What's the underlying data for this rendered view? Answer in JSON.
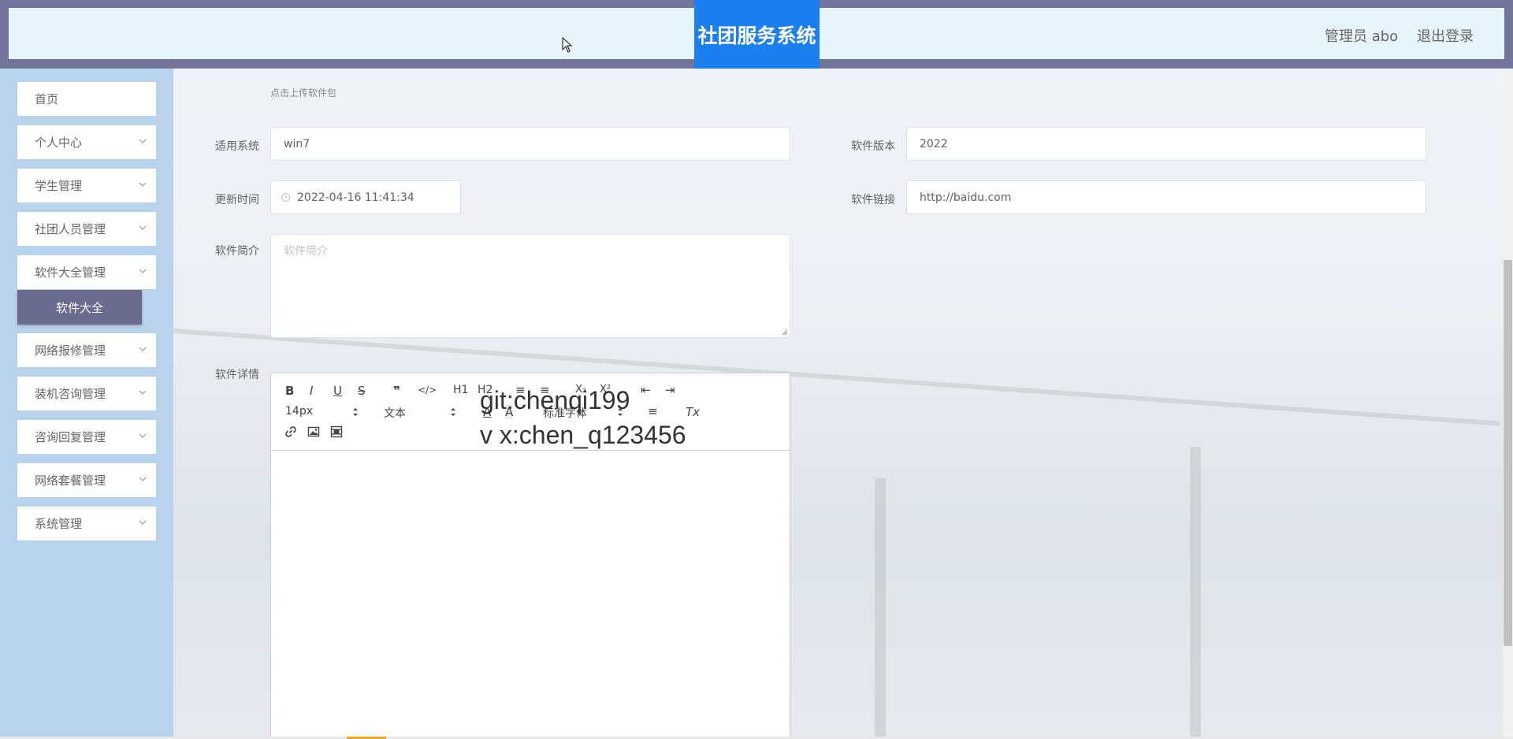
{
  "header": {
    "title": "社团服务系统",
    "admin": "管理员 abo",
    "logout": "退出登录"
  },
  "sidebar": {
    "items": [
      {
        "label": "首页"
      },
      {
        "label": "个人中心"
      },
      {
        "label": "学生管理"
      },
      {
        "label": "社团人员管理"
      },
      {
        "label": "软件大全管理"
      },
      {
        "label": "网络报修管理"
      },
      {
        "label": "装机咨询管理"
      },
      {
        "label": "咨询回复管理"
      },
      {
        "label": "网络套餐管理"
      },
      {
        "label": "系统管理"
      }
    ],
    "active_sub": "软件大全"
  },
  "form": {
    "upload_hint": "点击上传软件包",
    "system_label": "适用系统",
    "system_value": "win7",
    "version_label": "软件版本",
    "version_value": "2022",
    "update_label": "更新时间",
    "update_value": "2022-04-16 11:41:34",
    "link_label": "软件链接",
    "link_value": "http://baidu.com",
    "intro_label": "软件简介",
    "intro_placeholder": "软件简介",
    "detail_label": "软件详情"
  },
  "editor": {
    "toolbar": {
      "bold": "B",
      "italic": "I",
      "underline": "U",
      "strike": "S",
      "quote": "❞",
      "code": "</>",
      "h1": "H1",
      "h2": "H2",
      "ol": "≡",
      "ul": "≡",
      "sub": "X₂",
      "sup": "X²",
      "outdent": "⇤",
      "indent": "⇥",
      "size": "14px",
      "type": "文本",
      "font_color": "A",
      "bg_color": "A",
      "font": "标准字体",
      "align": "≡",
      "clean": "Tx"
    }
  },
  "watermark": {
    "line1": "git:chenqi199",
    "line2": "v x:chen_q123456"
  }
}
